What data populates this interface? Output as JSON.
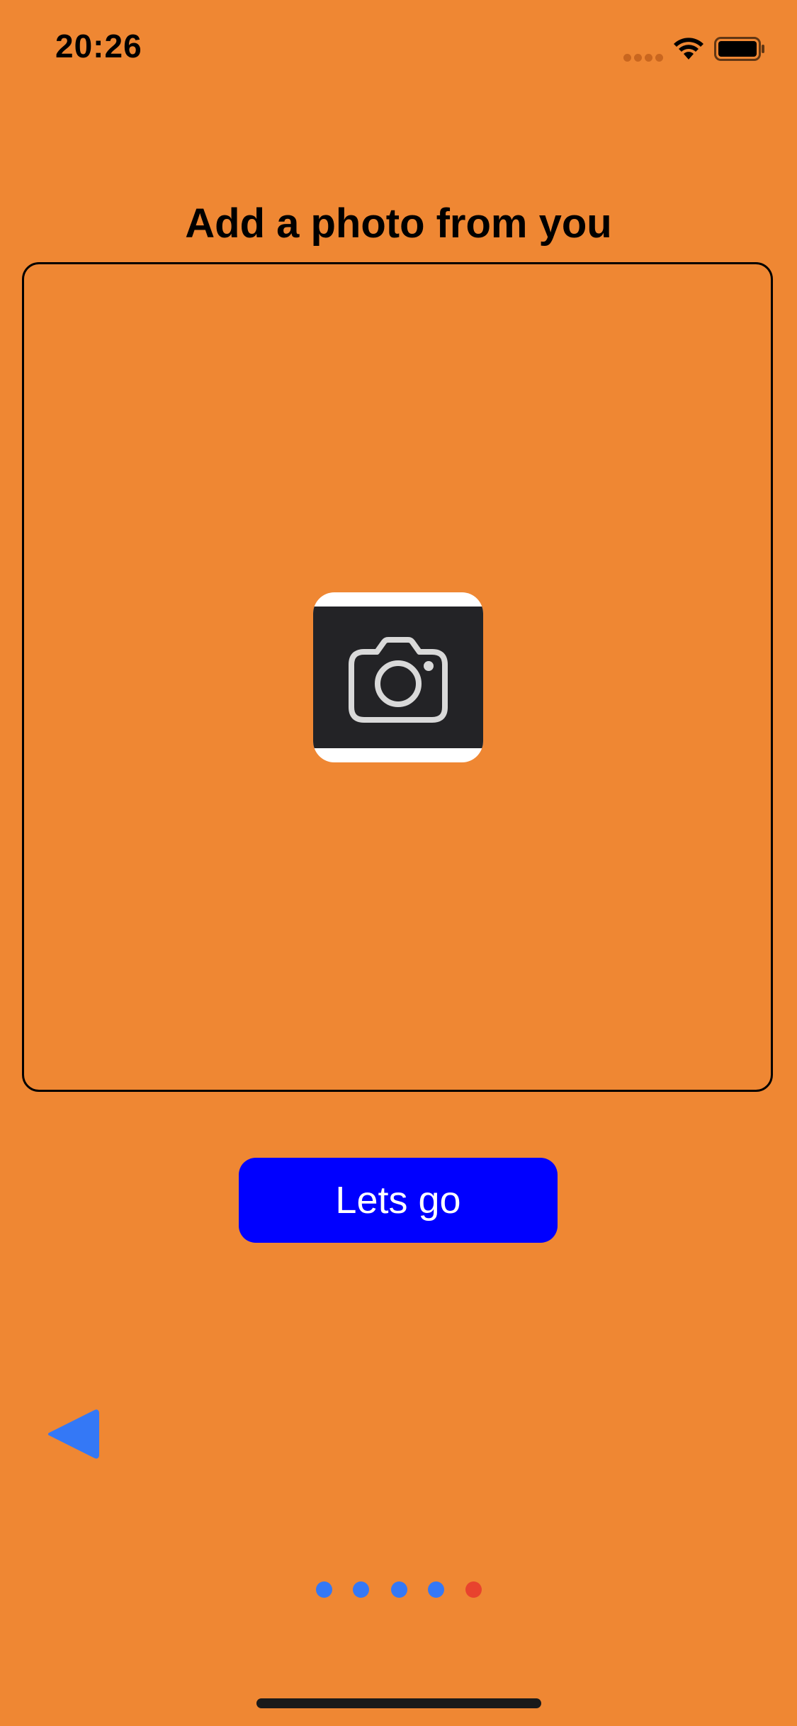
{
  "status_bar": {
    "time": "20:26"
  },
  "screen": {
    "title": "Add a photo from you",
    "photo_placeholder_icon": "camera-icon",
    "primary_button_label": "Lets go",
    "back_icon": "back-triangle-icon"
  },
  "pagination": {
    "total_pages": 5,
    "current_page": 5,
    "inactive_color": "#3478F6",
    "active_color": "#E8432E"
  },
  "colors": {
    "background": "#EF8733",
    "button": "#0000FF",
    "back_arrow": "#3478F6"
  }
}
